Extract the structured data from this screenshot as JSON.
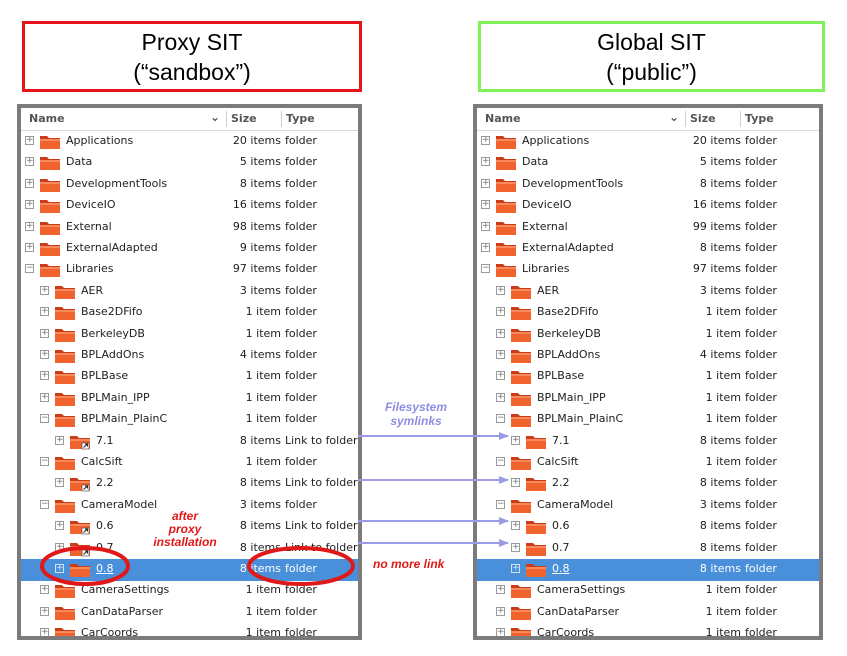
{
  "left": {
    "title_line1": "Proxy SIT",
    "title_line2": "(“sandbox”)",
    "columns": {
      "name": "Name",
      "size": "Size",
      "type": "Type"
    },
    "rows": [
      {
        "level": 0,
        "exp": "+",
        "name": "Applications",
        "size": "20 items",
        "type": "folder"
      },
      {
        "level": 0,
        "exp": "+",
        "name": "Data",
        "size": "5 items",
        "type": "folder"
      },
      {
        "level": 0,
        "exp": "+",
        "name": "DevelopmentTools",
        "size": "8 items",
        "type": "folder"
      },
      {
        "level": 0,
        "exp": "+",
        "name": "DeviceIO",
        "size": "16 items",
        "type": "folder"
      },
      {
        "level": 0,
        "exp": "+",
        "name": "External",
        "size": "98 items",
        "type": "folder"
      },
      {
        "level": 0,
        "exp": "+",
        "name": "ExternalAdapted",
        "size": "9 items",
        "type": "folder"
      },
      {
        "level": 0,
        "exp": "−",
        "name": "Libraries",
        "size": "97 items",
        "type": "folder"
      },
      {
        "level": 1,
        "exp": "+",
        "name": "AER",
        "size": "3 items",
        "type": "folder"
      },
      {
        "level": 1,
        "exp": "+",
        "name": "Base2DFifo",
        "size": "1 item",
        "type": "folder"
      },
      {
        "level": 1,
        "exp": "+",
        "name": "BerkeleyDB",
        "size": "1 item",
        "type": "folder"
      },
      {
        "level": 1,
        "exp": "+",
        "name": "BPLAddOns",
        "size": "4 items",
        "type": "folder"
      },
      {
        "level": 1,
        "exp": "+",
        "name": "BPLBase",
        "size": "1 item",
        "type": "folder"
      },
      {
        "level": 1,
        "exp": "+",
        "name": "BPLMain_IPP",
        "size": "1 item",
        "type": "folder"
      },
      {
        "level": 1,
        "exp": "−",
        "name": "BPLMain_PlainC",
        "size": "1 item",
        "type": "folder"
      },
      {
        "level": 2,
        "exp": "+",
        "name": "7.1",
        "size": "8 items",
        "type": "Link to folder",
        "link": true
      },
      {
        "level": 1,
        "exp": "−",
        "name": "CalcSift",
        "size": "1 item",
        "type": "folder"
      },
      {
        "level": 2,
        "exp": "+",
        "name": "2.2",
        "size": "8 items",
        "type": "Link to folder",
        "link": true
      },
      {
        "level": 1,
        "exp": "−",
        "name": "CameraModel",
        "size": "3 items",
        "type": "folder"
      },
      {
        "level": 2,
        "exp": "+",
        "name": "0.6",
        "size": "8 items",
        "type": "Link to folder",
        "link": true
      },
      {
        "level": 2,
        "exp": "+",
        "name": "0.7",
        "size": "8 items",
        "type": "Link to folder",
        "link": true
      },
      {
        "level": 2,
        "exp": "+",
        "name": "0.8",
        "size": "8 items",
        "type": "folder",
        "selected": true
      },
      {
        "level": 1,
        "exp": "+",
        "name": "CameraSettings",
        "size": "1 item",
        "type": "folder"
      },
      {
        "level": 1,
        "exp": "+",
        "name": "CanDataParser",
        "size": "1 item",
        "type": "folder"
      },
      {
        "level": 1,
        "exp": "+",
        "name": "CarCoords",
        "size": "1 item",
        "type": "folder"
      }
    ]
  },
  "right": {
    "title_line1": "Global SIT",
    "title_line2": "(“public”)",
    "columns": {
      "name": "Name",
      "size": "Size",
      "type": "Type"
    },
    "rows": [
      {
        "level": 0,
        "exp": "+",
        "name": "Applications",
        "size": "20 items",
        "type": "folder"
      },
      {
        "level": 0,
        "exp": "+",
        "name": "Data",
        "size": "5 items",
        "type": "folder"
      },
      {
        "level": 0,
        "exp": "+",
        "name": "DevelopmentTools",
        "size": "8 items",
        "type": "folder"
      },
      {
        "level": 0,
        "exp": "+",
        "name": "DeviceIO",
        "size": "16 items",
        "type": "folder"
      },
      {
        "level": 0,
        "exp": "+",
        "name": "External",
        "size": "99 items",
        "type": "folder"
      },
      {
        "level": 0,
        "exp": "+",
        "name": "ExternalAdapted",
        "size": "8 items",
        "type": "folder"
      },
      {
        "level": 0,
        "exp": "−",
        "name": "Libraries",
        "size": "97 items",
        "type": "folder"
      },
      {
        "level": 1,
        "exp": "+",
        "name": "AER",
        "size": "3 items",
        "type": "folder"
      },
      {
        "level": 1,
        "exp": "+",
        "name": "Base2DFifo",
        "size": "1 item",
        "type": "folder"
      },
      {
        "level": 1,
        "exp": "+",
        "name": "BerkeleyDB",
        "size": "1 item",
        "type": "folder"
      },
      {
        "level": 1,
        "exp": "+",
        "name": "BPLAddOns",
        "size": "4 items",
        "type": "folder"
      },
      {
        "level": 1,
        "exp": "+",
        "name": "BPLBase",
        "size": "1 item",
        "type": "folder"
      },
      {
        "level": 1,
        "exp": "+",
        "name": "BPLMain_IPP",
        "size": "1 item",
        "type": "folder"
      },
      {
        "level": 1,
        "exp": "−",
        "name": "BPLMain_PlainC",
        "size": "1 item",
        "type": "folder"
      },
      {
        "level": 2,
        "exp": "+",
        "name": "7.1",
        "size": "8 items",
        "type": "folder"
      },
      {
        "level": 1,
        "exp": "−",
        "name": "CalcSift",
        "size": "1 item",
        "type": "folder"
      },
      {
        "level": 2,
        "exp": "+",
        "name": "2.2",
        "size": "8 items",
        "type": "folder"
      },
      {
        "level": 1,
        "exp": "−",
        "name": "CameraModel",
        "size": "3 items",
        "type": "folder"
      },
      {
        "level": 2,
        "exp": "+",
        "name": "0.6",
        "size": "8 items",
        "type": "folder"
      },
      {
        "level": 2,
        "exp": "+",
        "name": "0.7",
        "size": "8 items",
        "type": "folder"
      },
      {
        "level": 2,
        "exp": "+",
        "name": "0.8",
        "size": "8 items",
        "type": "folder",
        "selected": true
      },
      {
        "level": 1,
        "exp": "+",
        "name": "CameraSettings",
        "size": "1 item",
        "type": "folder"
      },
      {
        "level": 1,
        "exp": "+",
        "name": "CanDataParser",
        "size": "1 item",
        "type": "folder"
      },
      {
        "level": 1,
        "exp": "+",
        "name": "CarCoords",
        "size": "1 item",
        "type": "folder"
      }
    ]
  },
  "annotations": {
    "filesystem_symlinks_line1": "Filesystem",
    "filesystem_symlinks_line2": "symlinks",
    "after_line1": "after",
    "after_line2": "proxy",
    "after_line3": "installation",
    "no_more_link": "no more link"
  },
  "colors": {
    "proxy_border": "#e8121b",
    "global_border": "#7ff25a",
    "selection": "#4a8fd9",
    "arrow": "#9b9be8",
    "highlight_ellipse": "#e01818",
    "folder": "#e8562a"
  }
}
